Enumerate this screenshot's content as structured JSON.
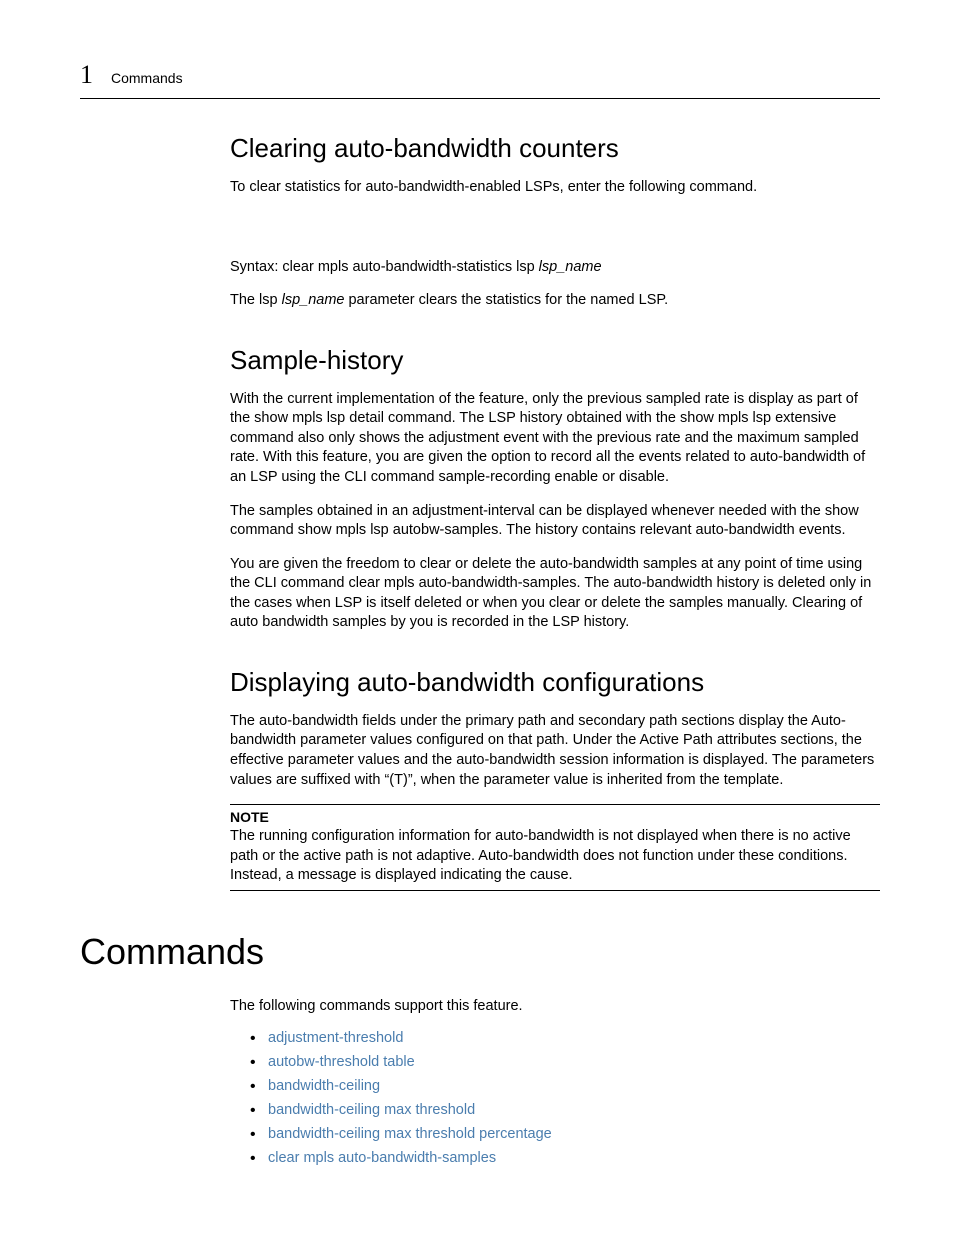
{
  "header": {
    "chapter_num": "1",
    "section": "Commands"
  },
  "sec1": {
    "heading": "Clearing auto-bandwidth counters",
    "intro": "To clear statistics for auto-bandwidth-enabled LSPs, enter the following command.",
    "syntax_prefix": "Syntax:  clear mpls auto-bandwidth-statistics lsp ",
    "syntax_arg": "lsp_name",
    "explain_pre": "The lsp ",
    "explain_arg": "lsp_name",
    "explain_post": " parameter clears the statistics for the named LSP."
  },
  "sec2": {
    "heading": "Sample-history",
    "p1": "With the current implementation of the feature, only the previous sampled rate is display as part of the show mpls lsp detail command. The LSP history obtained with the show mpls lsp extensive command also only shows the adjustment event with the previous rate and the maximum sampled rate. With this feature, you are given the option to record all the events related to auto-bandwidth of an LSP using the CLI command sample-recording enable or disable.",
    "p2": "The samples obtained in an adjustment-interval can be displayed whenever needed with the show command show mpls lsp autobw-samples. The history contains relevant auto-bandwidth events.",
    "p3": "You are given the freedom to clear or delete the auto-bandwidth samples at any point of time using the CLI command clear mpls auto-bandwidth-samples. The auto-bandwidth history is deleted only in the cases when LSP is itself deleted or when you clear or delete the samples manually. Clearing of auto bandwidth samples by you is recorded in the LSP history."
  },
  "sec3": {
    "heading": "Displaying auto-bandwidth configurations",
    "p1": "The auto-bandwidth fields under the primary path and secondary path sections display the Auto-bandwidth parameter values configured on that path. Under the Active Path attributes sections, the effective parameter values and the auto-bandwidth session information is displayed. The parameters values are suffixed with “(T)”, when the parameter value is inherited from the template.",
    "note_label": "NOTE",
    "note_body": "The running configuration information for auto-bandwidth is not displayed when there is no active path or the active path is not adaptive. Auto-bandwidth does not function under these conditions. Instead, a message is displayed indicating the cause."
  },
  "commands": {
    "heading": "Commands",
    "intro": "The following commands support this feature.",
    "items": [
      "adjustment-threshold",
      "autobw-threshold table",
      "bandwidth-ceiling",
      "bandwidth-ceiling max threshold",
      "bandwidth-ceiling max threshold percentage",
      "clear mpls auto-bandwidth-samples"
    ]
  }
}
